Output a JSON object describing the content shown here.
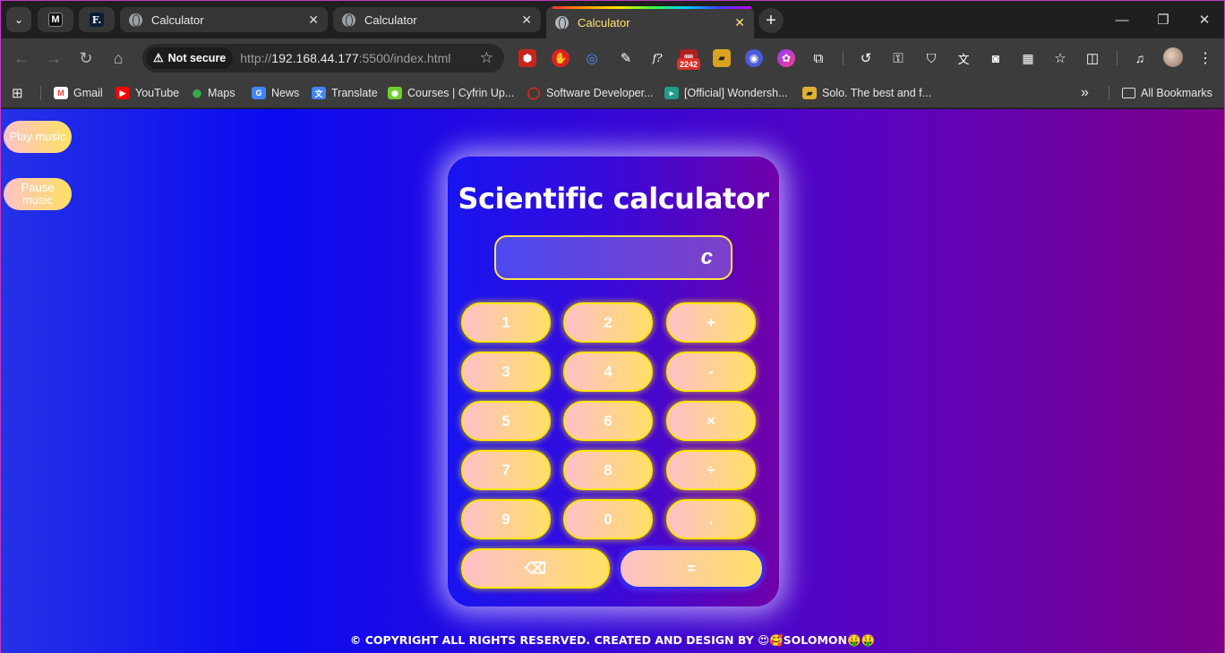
{
  "tabs": {
    "pinned": [
      {
        "icon": "m-logo-icon",
        "glyph": "M"
      },
      {
        "icon": "f-logo-icon",
        "glyph": "F."
      }
    ],
    "items": [
      {
        "title": "Calculator",
        "active": false
      },
      {
        "title": "Calculator",
        "active": false
      },
      {
        "title": "Calculator",
        "active": true
      }
    ],
    "close_glyph": "✕"
  },
  "toolbar": {
    "security_label": "Not secure",
    "url_scheme": "http://",
    "url_host": "192.168.44.177",
    "url_rest": ":5500/index.html",
    "ext_badge": "2242"
  },
  "bookmarks": {
    "items": [
      {
        "label": "Gmail",
        "color": "#ea4335",
        "glyph": "M"
      },
      {
        "label": "YouTube",
        "color": "#ff0000",
        "glyph": "▶"
      },
      {
        "label": "Maps",
        "color": "#34a853",
        "glyph": "⬤"
      },
      {
        "label": "News",
        "color": "#4285f4",
        "glyph": "G"
      },
      {
        "label": "Translate",
        "color": "#4285f4",
        "glyph": "文"
      },
      {
        "label": "Courses | Cyfrin Up...",
        "color": "#6fcf2f",
        "glyph": "◉"
      },
      {
        "label": "Software Developer...",
        "color": "#e8261a",
        "glyph": "◯"
      },
      {
        "label": "[Official] Wondersh...",
        "color": "#1f9c8a",
        "glyph": "▸"
      },
      {
        "label": "Solo. The best and f...",
        "color": "#e0b230",
        "glyph": "▰"
      }
    ],
    "overflow": "»",
    "all_bookmarks": "All Bookmarks"
  },
  "page": {
    "play_music": "Play music",
    "pause_music": "Pause music",
    "title": "Scientific calculator",
    "display_value": "c",
    "keys": [
      "1",
      "2",
      "+",
      "3",
      "4",
      "-",
      "5",
      "6",
      "×",
      "7",
      "8",
      "÷",
      "9",
      "0",
      ".",
      "⌫",
      "="
    ],
    "footer": "© COPYRIGHT ALL RIGHTS RESERVED. CREATED AND DESIGN BY 😍🥰SOLOMON🤑🤑"
  },
  "colors": {
    "accent_tab": "#ffe36e",
    "key_border": "#ffe600",
    "page_gradient_start": "#2432e6",
    "page_gradient_end": "#7b0088"
  }
}
